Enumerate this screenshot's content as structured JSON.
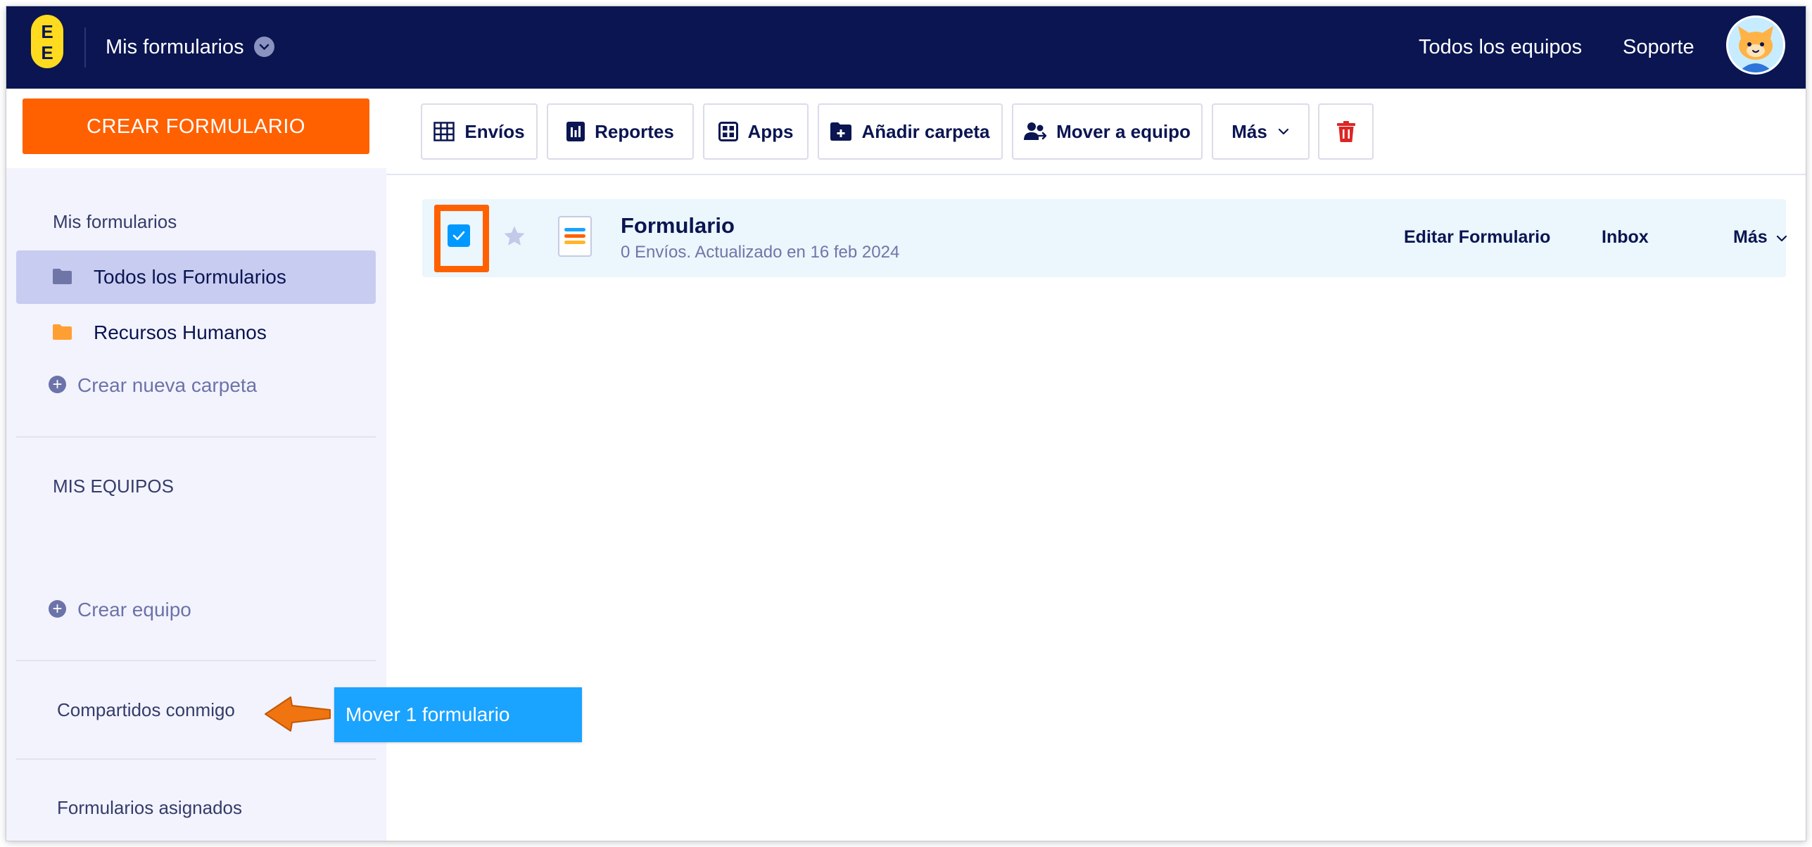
{
  "header": {
    "title": "Mis formularios",
    "links": [
      "Todos los equipos",
      "Soporte"
    ],
    "logo_letters": [
      "E",
      "E"
    ]
  },
  "sidebar": {
    "create_button": "CREAR FORMULARIO",
    "section_my_forms": "Mis formularios",
    "items": [
      {
        "label": "Todos los Formularios",
        "icon": "folder-icon",
        "color": "#6f76a7",
        "active": true
      },
      {
        "label": "Recursos Humanos",
        "icon": "folder-icon",
        "color": "#ff9f33",
        "active": false
      }
    ],
    "new_folder": "Crear nueva carpeta",
    "section_teams": "MIS EQUIPOS",
    "new_team": "Crear equipo",
    "shared": "Compartidos conmigo",
    "assigned": "Formularios asignados"
  },
  "toolbar": {
    "submissions": "Envíos",
    "reports": "Reportes",
    "apps": "Apps",
    "add_folder": "Añadir carpeta",
    "move_team": "Mover a equipo",
    "more": "Más"
  },
  "form_row": {
    "title": "Formulario",
    "meta": "0 Envíos. Actualizado en 16 feb 2024",
    "edit": "Editar Formulario",
    "inbox": "Inbox",
    "more": "Más",
    "checked": true,
    "starred": false
  },
  "tooltip": {
    "text": "Mover 1 formulario"
  },
  "colors": {
    "navy": "#0a1551",
    "accent_orange": "#ff6100",
    "tooltip_blue": "#1aa3ff",
    "danger": "#dc2626",
    "checkbox": "#0099ff"
  }
}
